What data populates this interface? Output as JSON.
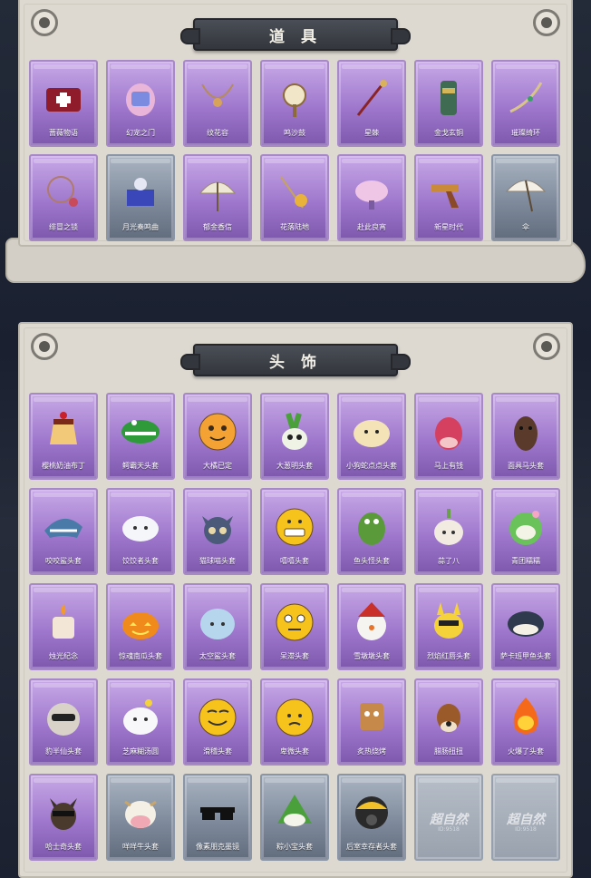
{
  "sections": [
    {
      "title": "道 具",
      "items": [
        {
          "label": "蔷薇物语",
          "icon": "first-aid-kit-icon",
          "tier": "purple"
        },
        {
          "label": "幻宠之门",
          "icon": "pet-device-icon",
          "tier": "purple"
        },
        {
          "label": "纹花容",
          "icon": "ornament-icon",
          "tier": "purple"
        },
        {
          "label": "鸣沙鼓",
          "icon": "clock-drum-icon",
          "tier": "purple"
        },
        {
          "label": "星棘",
          "icon": "staff-icon",
          "tier": "purple"
        },
        {
          "label": "金戈玄铜",
          "icon": "flashlight-icon",
          "tier": "purple"
        },
        {
          "label": "璀璨绮环",
          "icon": "bow-icon",
          "tier": "purple"
        },
        {
          "label": "绯冒之锁",
          "icon": "necklace-icon",
          "tier": "purple"
        },
        {
          "label": "月光奏鸣曲",
          "icon": "music-box-icon",
          "tier": "grey"
        },
        {
          "label": "郁金香信",
          "icon": "parasol-icon",
          "tier": "purple"
        },
        {
          "label": "花落陆地",
          "icon": "flower-rod-icon",
          "tier": "purple"
        },
        {
          "label": "赴此良宵",
          "icon": "lamp-icon",
          "tier": "purple"
        },
        {
          "label": "新星时代",
          "icon": "revolver-icon",
          "tier": "purple"
        },
        {
          "label": "伞",
          "icon": "umbrella-icon",
          "tier": "grey"
        }
      ]
    },
    {
      "title": "头 饰",
      "items": [
        {
          "label": "樱桃奶油布丁",
          "icon": "pudding-icon",
          "tier": "purple"
        },
        {
          "label": "鳄霸天头套",
          "icon": "crocodile-icon",
          "tier": "purple"
        },
        {
          "label": "大橘已定",
          "icon": "orange-icon",
          "tier": "purple"
        },
        {
          "label": "大葱明头套",
          "icon": "scallion-icon",
          "tier": "purple"
        },
        {
          "label": "小狗蛇点点头套",
          "icon": "puppy-icon",
          "tier": "purple"
        },
        {
          "label": "马上有钱",
          "icon": "red-horse-icon",
          "tier": "purple"
        },
        {
          "label": "面具马头套",
          "icon": "horse-mask-icon",
          "tier": "purple"
        },
        {
          "label": "咬咬鲨头套",
          "icon": "shark-icon",
          "tier": "purple"
        },
        {
          "label": "饺饺者头套",
          "icon": "cloud-icon",
          "tier": "purple"
        },
        {
          "label": "猫球喵头套",
          "icon": "cat-icon",
          "tier": "purple"
        },
        {
          "label": "嘻嘻头套",
          "icon": "grin-emoji-icon",
          "tier": "purple"
        },
        {
          "label": "鱼头怪头套",
          "icon": "fish-head-icon",
          "tier": "purple"
        },
        {
          "label": "蒜了八",
          "icon": "garlic-icon",
          "tier": "purple"
        },
        {
          "label": "青团糯糯",
          "icon": "rice-cake-icon",
          "tier": "purple"
        },
        {
          "label": "烛光纪念",
          "icon": "candle-icon",
          "tier": "purple"
        },
        {
          "label": "惊魂南瓜头套",
          "icon": "pumpkin-icon",
          "tier": "purple"
        },
        {
          "label": "太空鲨头套",
          "icon": "space-shark-icon",
          "tier": "purple"
        },
        {
          "label": "呆滞头套",
          "icon": "dazed-emoji-icon",
          "tier": "purple"
        },
        {
          "label": "雪墩墩头套",
          "icon": "snowman-icon",
          "tier": "purple"
        },
        {
          "label": "烈焰红唇头套",
          "icon": "pikachu-icon",
          "tier": "purple"
        },
        {
          "label": "萨卡班甲鱼头套",
          "icon": "fish-icon",
          "tier": "purple"
        },
        {
          "label": "豹半仙头套",
          "icon": "raccoon-icon",
          "tier": "purple"
        },
        {
          "label": "芝麻糊汤圆",
          "icon": "dumpling-icon",
          "tier": "purple"
        },
        {
          "label": "滑稽头套",
          "icon": "smirk-emoji-icon",
          "tier": "purple"
        },
        {
          "label": "卑微头套",
          "icon": "worried-emoji-icon",
          "tier": "purple"
        },
        {
          "label": "炙热烧烤",
          "icon": "grill-icon",
          "tier": "purple"
        },
        {
          "label": "腊肠扭扭",
          "icon": "dog-icon",
          "tier": "purple"
        },
        {
          "label": "火爆了头套",
          "icon": "fire-icon",
          "tier": "purple"
        },
        {
          "label": "哈士奇头套",
          "icon": "husky-icon",
          "tier": "purple"
        },
        {
          "label": "咩咩牛头套",
          "icon": "cow-icon",
          "tier": "grey"
        },
        {
          "label": "像素朋克墨镜",
          "icon": "pixel-glasses-icon",
          "tier": "grey"
        },
        {
          "label": "粽小宝头套",
          "icon": "zongzi-icon",
          "tier": "grey"
        },
        {
          "label": "后室幸存者头套",
          "icon": "gas-mask-icon",
          "tier": "grey"
        },
        {
          "label": "",
          "icon": "placeholder-logo-icon",
          "tier": "empty",
          "brand": "超自然",
          "brand_sub": "ID:9518"
        },
        {
          "label": "",
          "icon": "placeholder-logo-icon",
          "tier": "empty",
          "brand": "超自然",
          "brand_sub": "ID:9518"
        }
      ]
    }
  ]
}
